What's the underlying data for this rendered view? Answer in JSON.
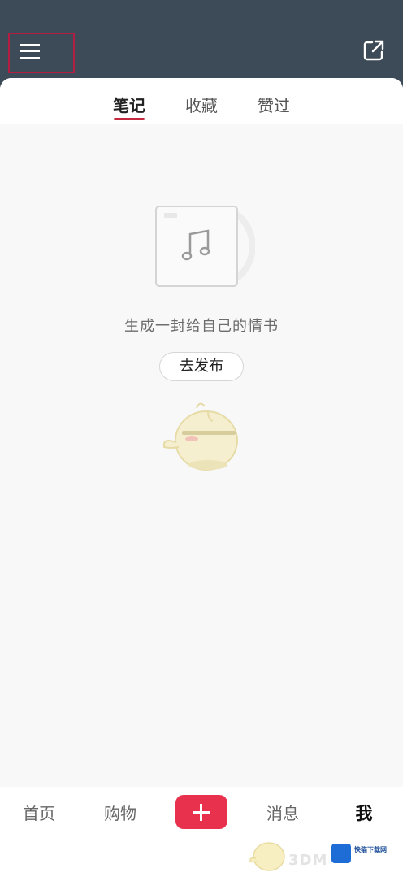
{
  "header": {
    "menu_icon": "menu-icon",
    "share_icon": "share-icon"
  },
  "tabs": [
    {
      "label": "笔记",
      "active": true
    },
    {
      "label": "收藏",
      "active": false
    },
    {
      "label": "赞过",
      "active": false
    }
  ],
  "empty_state": {
    "icon": "music-note-icon",
    "message": "生成一封给自己的情书",
    "button_label": "去发布"
  },
  "bottom_nav": [
    {
      "label": "首页",
      "active": false
    },
    {
      "label": "购物",
      "active": false
    },
    {
      "label": "消息",
      "active": false
    },
    {
      "label": "我",
      "active": true
    }
  ],
  "watermark": {
    "text": "3DM",
    "site": "快猫下载网"
  },
  "colors": {
    "header_bg": "#3d4a57",
    "accent": "#e8324d",
    "highlight_box": "#b21d43"
  }
}
